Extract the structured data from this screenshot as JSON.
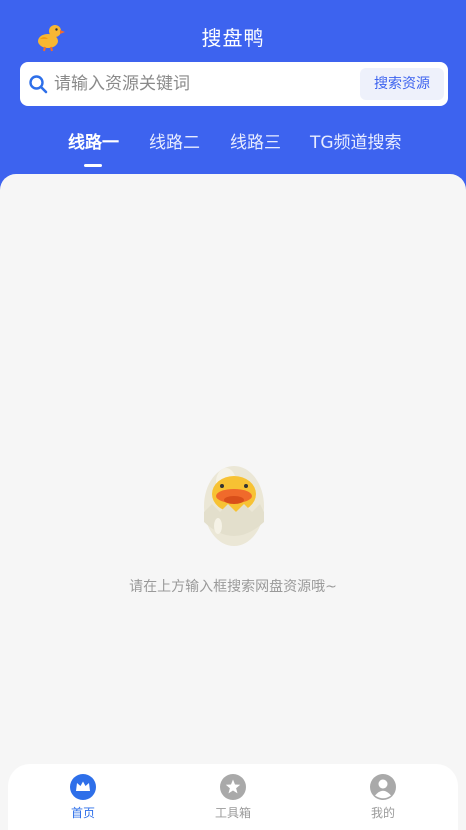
{
  "header": {
    "title": "搜盘鸭",
    "logo_icon": "duck-logo-icon",
    "background": "#3d63ef"
  },
  "search": {
    "placeholder": "请输入资源关键词",
    "value": "",
    "button_label": "搜索资源",
    "icon": "search-icon"
  },
  "tabs": [
    {
      "label": "线路一",
      "active": true
    },
    {
      "label": "线路二",
      "active": false
    },
    {
      "label": "线路三",
      "active": false
    },
    {
      "label": "TG频道搜索",
      "active": false
    }
  ],
  "empty_state": {
    "illustration": "duck-in-egg-icon",
    "text": "请在上方输入框搜索网盘资源哦~"
  },
  "bottom_nav": {
    "items": [
      {
        "label": "首页",
        "icon": "crown-icon",
        "active": true
      },
      {
        "label": "工具箱",
        "icon": "star-icon",
        "active": false
      },
      {
        "label": "我的",
        "icon": "user-icon",
        "active": false
      }
    ],
    "active_color": "#2e6fe9",
    "inactive_color": "#9a9a9a"
  }
}
